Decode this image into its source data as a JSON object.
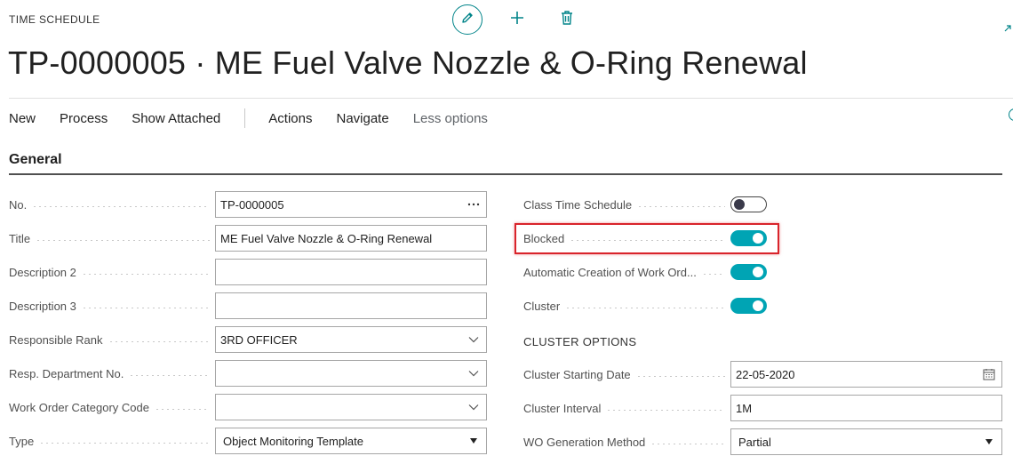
{
  "header": {
    "page_type": "TIME SCHEDULE",
    "title": "TP-0000005 · ME Fuel Valve Nozzle & O-Ring Renewal",
    "icons": [
      "edit-icon",
      "plus-icon",
      "trash-icon"
    ]
  },
  "actionbar": {
    "items": [
      "New",
      "Process",
      "Show Attached"
    ],
    "items2": [
      "Actions",
      "Navigate"
    ],
    "less_options": "Less options"
  },
  "section": {
    "title": "General"
  },
  "left_fields": [
    {
      "label": "No.",
      "value": "TP-0000005",
      "control": "assist-edit"
    },
    {
      "label": "Title",
      "value": "ME Fuel Valve Nozzle & O-Ring Renewal",
      "control": "text"
    },
    {
      "label": "Description 2",
      "value": "",
      "control": "text"
    },
    {
      "label": "Description 3",
      "value": "",
      "control": "text"
    },
    {
      "label": "Responsible Rank",
      "value": "3RD OFFICER",
      "control": "lookup"
    },
    {
      "label": "Resp. Department No.",
      "value": "",
      "control": "lookup"
    },
    {
      "label": "Work Order Category Code",
      "value": "",
      "control": "lookup"
    },
    {
      "label": "Type",
      "value": "Object Monitoring Template",
      "control": "select"
    }
  ],
  "right_toggles": [
    {
      "label": "Class Time Schedule",
      "on": false
    },
    {
      "label": "Blocked",
      "on": true
    },
    {
      "label": "Automatic Creation of Work Ord...",
      "on": true
    },
    {
      "label": "Cluster",
      "on": true
    }
  ],
  "cluster_options": {
    "caption": "CLUSTER OPTIONS",
    "fields": [
      {
        "label": "Cluster Starting Date",
        "value": "22-05-2020",
        "control": "date"
      },
      {
        "label": "Cluster Interval",
        "value": "1M",
        "control": "text"
      },
      {
        "label": "WO Generation Method",
        "value": "Partial",
        "control": "select"
      }
    ]
  },
  "colors": {
    "accent": "#008489",
    "toggle_on": "#00a4b4",
    "highlight": "#d9242b"
  }
}
